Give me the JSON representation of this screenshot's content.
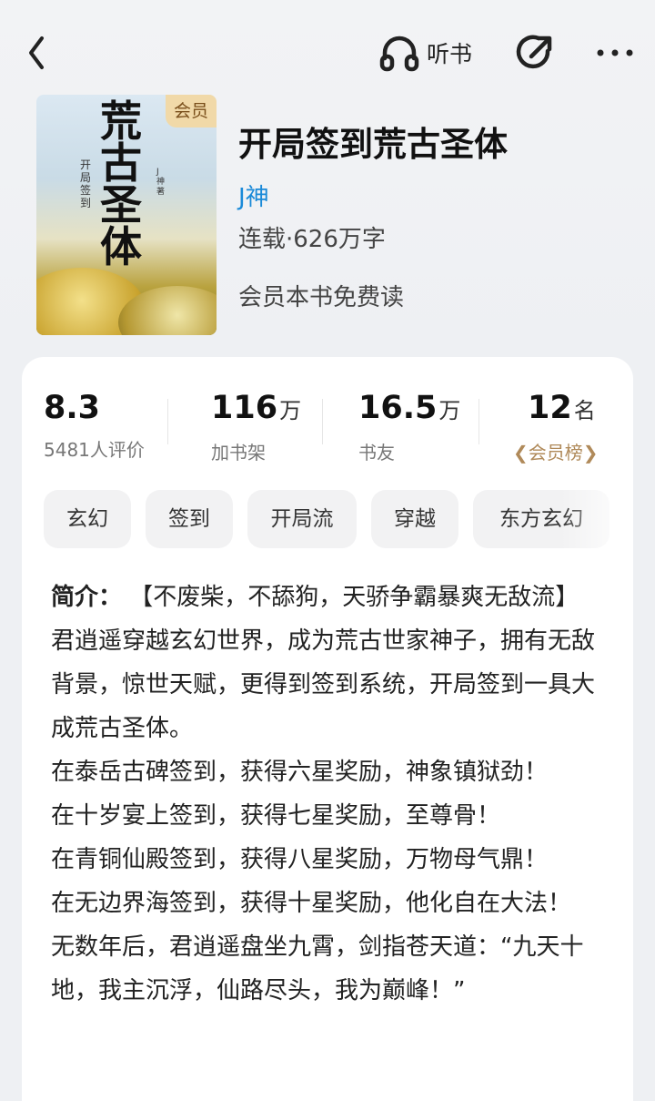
{
  "header": {
    "listen_label": "听书",
    "icons": [
      "back-arrow-icon",
      "headphones-icon",
      "share-icon",
      "more-icon"
    ]
  },
  "book": {
    "title": "开局签到荒古圣体",
    "author": "J神",
    "meta": "连载·626万字",
    "promo": "会员本书免费读",
    "cover": {
      "vip_tag": "会员",
      "title_vertical": "荒古圣体",
      "subtitle_vertical": "开局签到",
      "author_vertical": "J神著"
    }
  },
  "stats": [
    {
      "value": "8.3",
      "unit": "",
      "label": "5481人评价"
    },
    {
      "value": "116",
      "unit": "万",
      "label": "加书架"
    },
    {
      "value": "16.5",
      "unit": "万",
      "label": "书友"
    },
    {
      "value": "12",
      "unit": "名",
      "label": "会员榜"
    }
  ],
  "tags": [
    "玄幻",
    "签到",
    "开局流",
    "穿越",
    "东方玄幻"
  ],
  "intro": {
    "label": "简介：",
    "lead": "【不废柴，不舔狗，天骄争霸暴爽无敌流】",
    "paragraphs": [
      "君逍遥穿越玄幻世界，成为荒古世家神子，拥有无敌背景，惊世天赋，更得到签到系统，开局签到一具大成荒古圣体。",
      "在泰岳古碑签到，获得六星奖励，神象镇狱劲！",
      "在十岁宴上签到，获得七星奖励，至尊骨！",
      "在青铜仙殿签到，获得八星奖励，万物母气鼎！",
      "在无边界海签到，获得十星奖励，他化自在大法！",
      "无数年后，君逍遥盘坐九霄，剑指苍天道：“九天十地，我主沉浮，仙路尽头，我为巅峰！”"
    ]
  },
  "colors": {
    "author": "#1a8ad8",
    "rank": "#b08a5a",
    "vip_tag_bg": "#f1d9a8"
  }
}
